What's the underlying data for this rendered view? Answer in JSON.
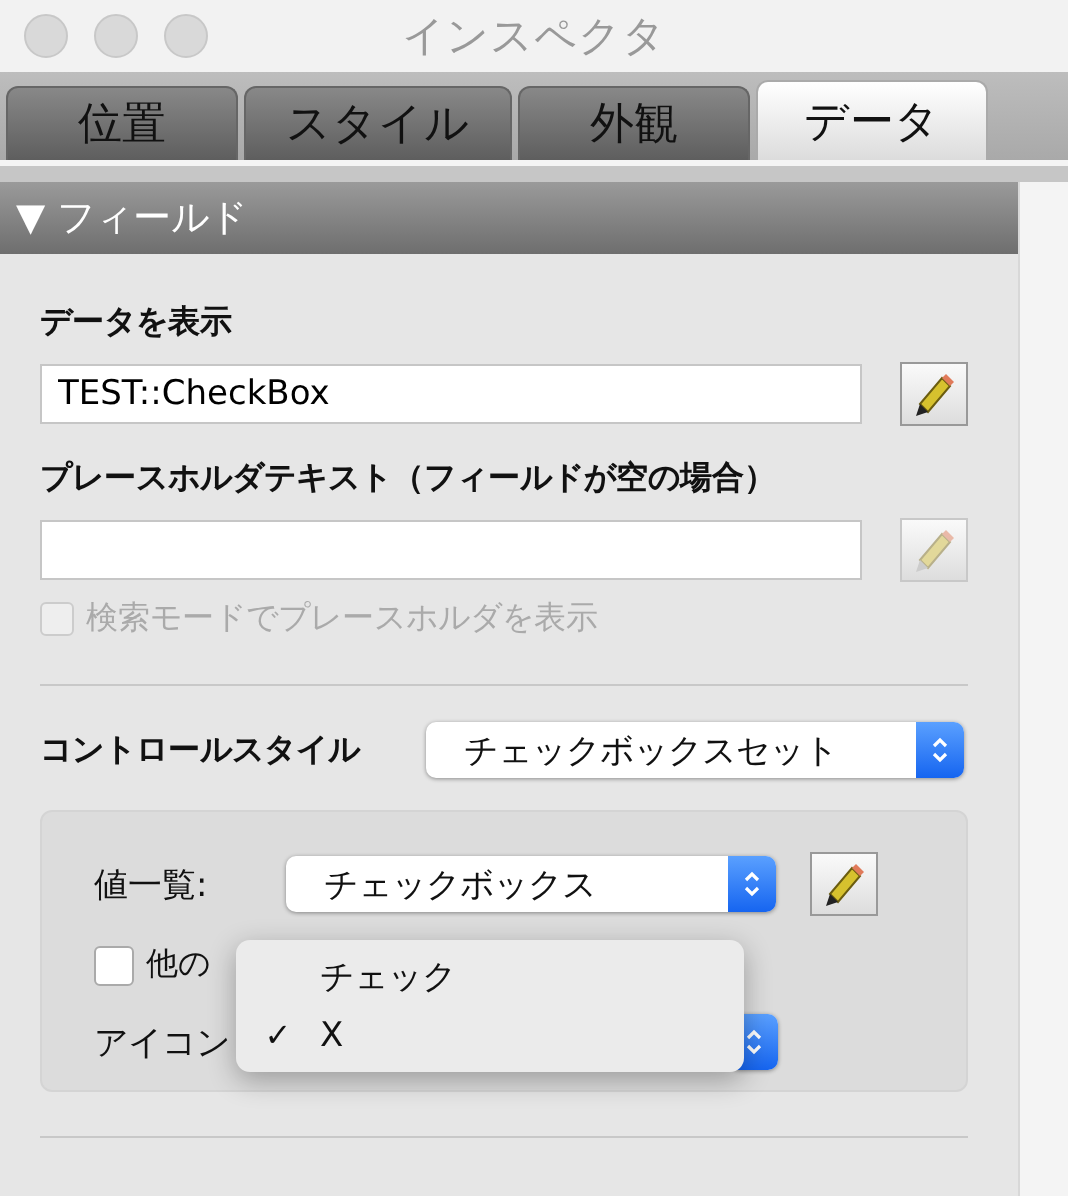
{
  "window": {
    "title": "インスペクタ"
  },
  "tabs": [
    {
      "label": "位置",
      "selected": false
    },
    {
      "label": "スタイル",
      "selected": false
    },
    {
      "label": "外観",
      "selected": false
    },
    {
      "label": "データ",
      "selected": true
    }
  ],
  "section": {
    "arrow": "▼",
    "title": "フィールド"
  },
  "display_data": {
    "label": "データを表示",
    "value": "TEST::CheckBox",
    "edit_disabled": false
  },
  "placeholder_text": {
    "label": "プレースホルダテキスト（フィールドが空の場合）",
    "edit_disabled": true
  },
  "search_mode_option": {
    "label": "検索モードでプレースホルダを表示",
    "checked": false,
    "disabled": true
  },
  "control_style": {
    "label": "コントロールスタイル",
    "value": "チェックボックスセット"
  },
  "value_list": {
    "label": "値一覧:",
    "value": "チェックボックス",
    "edit_disabled": false
  },
  "other_values_option": {
    "label": "他の",
    "checked": false,
    "disabled": false
  },
  "icon": {
    "label": "アイコン"
  },
  "menu": {
    "mark": "✓",
    "items": [
      {
        "label": "チェック",
        "selected": false
      },
      {
        "label": "X",
        "selected": true
      }
    ]
  }
}
